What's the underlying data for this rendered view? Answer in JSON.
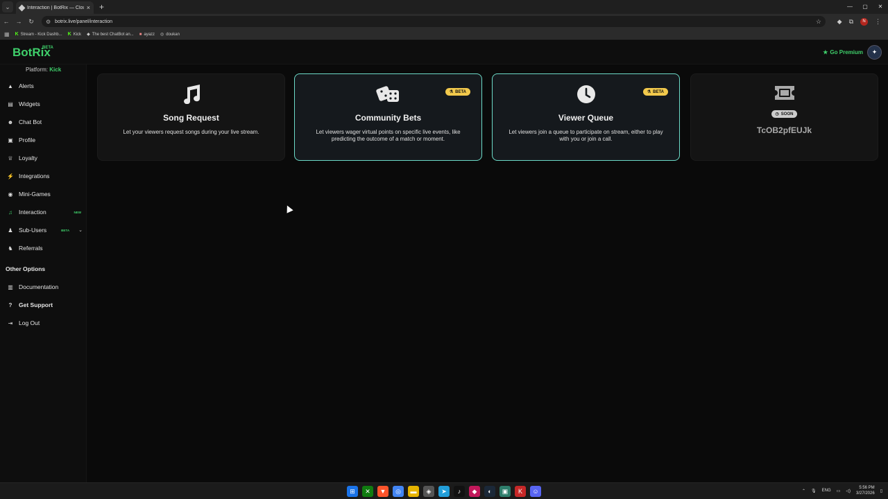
{
  "browser": {
    "tab_title": "Interaction | BotRix — Cloud St",
    "url": "botrix.live/panel/interaction",
    "bookmarks": [
      {
        "label": "Stream - Kick Dashb..."
      },
      {
        "label": "Kick"
      },
      {
        "label": "The best ChatBot an..."
      },
      {
        "label": "ayazz"
      },
      {
        "label": "doukan"
      }
    ],
    "profile_initial": "N"
  },
  "app": {
    "logo": "BotRix",
    "logo_badge": "BETA",
    "premium_label": "Go Premium",
    "platform_label": "Platform:",
    "platform_value": "Kick"
  },
  "sidebar": {
    "items": [
      {
        "label": "Alerts",
        "icon": "alert-icon"
      },
      {
        "label": "Widgets",
        "icon": "widgets-icon"
      },
      {
        "label": "Chat Bot",
        "icon": "bot-icon"
      },
      {
        "label": "Profile",
        "icon": "profile-icon"
      },
      {
        "label": "Loyalty",
        "icon": "trophy-icon"
      },
      {
        "label": "Integrations",
        "icon": "plug-icon"
      },
      {
        "label": "Mini-Games",
        "icon": "gamepad-icon"
      },
      {
        "label": "Interaction",
        "icon": "music-note-icon",
        "badge": "NEW",
        "active": true
      },
      {
        "label": "Sub-Users",
        "icon": "users-icon",
        "badge": "BETA"
      },
      {
        "label": "Referrals",
        "icon": "referrals-icon"
      }
    ],
    "other_title": "Other Options",
    "other_items": [
      {
        "label": "Documentation",
        "icon": "book-icon"
      },
      {
        "label": "Get Support",
        "icon": "help-icon"
      },
      {
        "label": "Log Out",
        "icon": "logout-icon"
      }
    ]
  },
  "cards": [
    {
      "title": "Song Request",
      "description": "Let your viewers request songs during your live stream.",
      "icon": "music-note-icon"
    },
    {
      "title": "Community Bets",
      "description": "Let viewers wager virtual points on specific live events, like predicting the outcome of a match or moment.",
      "badge": "BETA",
      "icon": "dice-icon"
    },
    {
      "title": "Viewer Queue",
      "description": "Let viewers join a queue to participate on stream, either to play with you or join a call.",
      "badge": "BETA",
      "icon": "clock-icon"
    },
    {
      "title": "TcOB2pfEUJk",
      "badge": "SOON",
      "icon": "ticket-icon"
    }
  ],
  "taskbar": {
    "lang": "ENG",
    "time": "5:56 PM",
    "date": "3/27/2026"
  },
  "colors": {
    "accent": "#3fd06b",
    "card_border": "#6ddcc9",
    "beta_badge": "#f2c94c"
  }
}
